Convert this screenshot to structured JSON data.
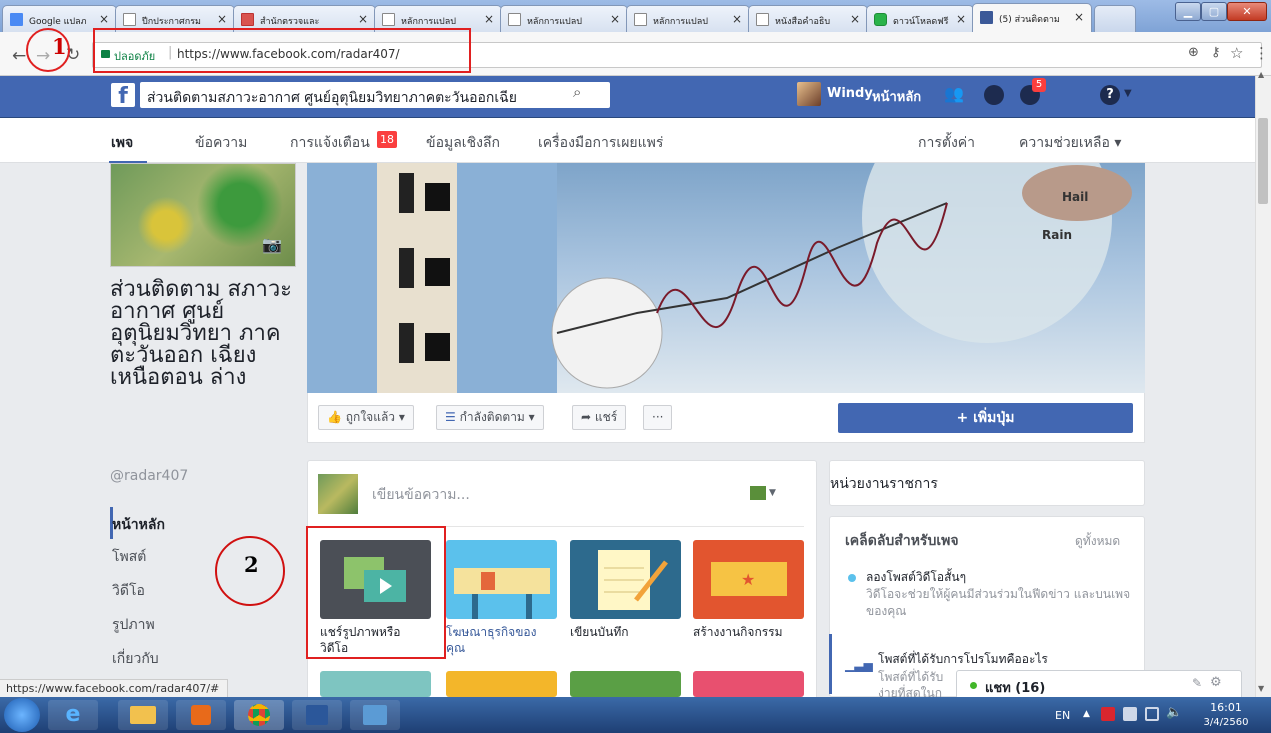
{
  "browser": {
    "tabs": [
      {
        "label": "Google แปลภ"
      },
      {
        "label": "ปีกประกาศกรม"
      },
      {
        "label": "สำนักตรวจและ"
      },
      {
        "label": "หลักการแปลป"
      },
      {
        "label": "หลักการแปลป"
      },
      {
        "label": "หลักการแปลป"
      },
      {
        "label": "หนังสือคำอธิบ"
      },
      {
        "label": "ดาวน์โหลดฟรี"
      },
      {
        "label": "(5) ส่วนติดตาม"
      }
    ],
    "secure_label": "ปลอดภัย",
    "url": "https://www.facebook.com/radar407/",
    "status_url": "https://www.facebook.com/radar407/#"
  },
  "annotations": {
    "one": "1",
    "two": "2"
  },
  "fb": {
    "search_value": "ส่วนติดตามสภาวะอากาศ ศูนย์อุตุนิยมวิทยาภาคตะวันออกเฉีย",
    "user_name": "Windy",
    "home_label": "หน้าหลัก",
    "notif_count": "5"
  },
  "page_nav": {
    "page": "เพจ",
    "messages": "ข้อความ",
    "notifications": "การแจ้งเตือน",
    "notifications_count": "18",
    "insights": "ข้อมูลเชิงลึก",
    "publishing_tools": "เครื่องมือการเผยแพร่",
    "settings": "การตั้งค่า",
    "help": "ความช่วยเหลือ ▾"
  },
  "profile": {
    "name": "ส่วนติดตาม สภาวะอากาศ ศูนย์ อุตุนิยมวิทยา ภาคตะวันออก เฉียงเหนือตอน ล่าง",
    "handle": "@radar407",
    "menu": [
      "หน้าหลัก",
      "โพสต์",
      "วิดีโอ",
      "รูปภาพ",
      "เกี่ยวกับ"
    ]
  },
  "cover": {
    "hail": "Hail",
    "rain": "Rain"
  },
  "actions": {
    "liked": "ถูกใจแล้ว ▾",
    "following": "กำลังติดตาม ▾",
    "share": "แชร์",
    "more": "···",
    "add_button": "+ เพิ่มปุ่ม"
  },
  "composer": {
    "placeholder": "เขียนข้อความ...",
    "tiles": [
      "แชร์รูปภาพหรือ วิดีโอ",
      "โฆษณาธุรกิจของ คุณ",
      "เขียนบันทึก",
      "สร้างงานกิจกรรม"
    ]
  },
  "right": {
    "category": "หน่วยงานราชการ",
    "tips_title": "เคล็ดลับสำหรับเพจ",
    "see_all": "ดูทั้งหมด",
    "tip1_title": "ลองโพสต์วิดีโอสั้นๆ",
    "tip1_body": "วิดีโอจะช่วยให้ผู้คนมีส่วนร่วมในฟีดข่าว และบนเพจของคุณ",
    "tip2_title": "โพสต์ที่ได้รับการโปรโมทคืออะไร",
    "tip2_body": "โพสต์ที่ได้รับ",
    "tip2_body2": "ง่ายที่สุดในก"
  },
  "chat": {
    "label": "แชท (16)"
  },
  "taskbar": {
    "lang": "EN",
    "time": "16:01",
    "date": "3/4/2560"
  }
}
